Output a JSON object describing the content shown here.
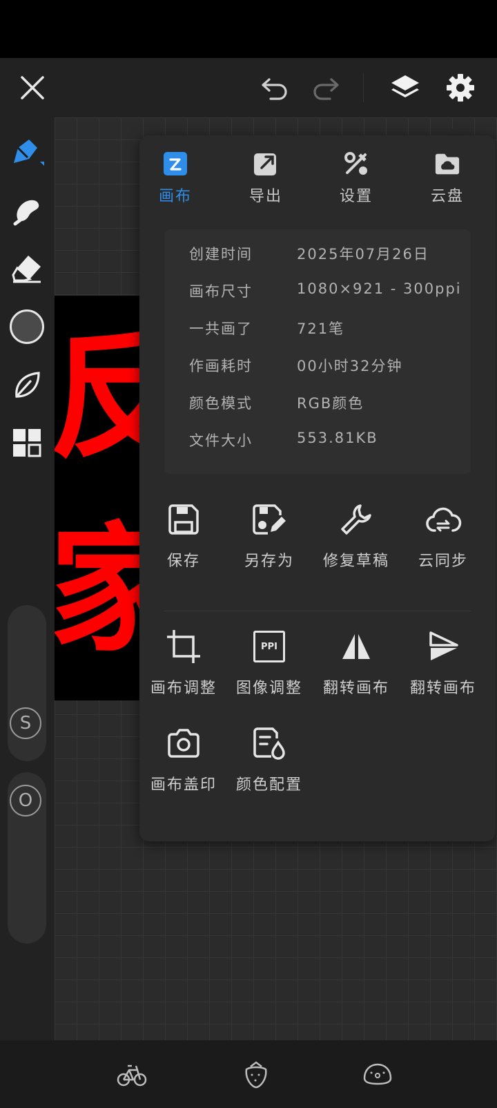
{
  "colors": {
    "accent": "#2e8eea",
    "stroke": "#ff0000"
  },
  "topbar": {
    "close_icon": "close-icon",
    "undo_icon": "undo-icon",
    "redo_icon": "redo-icon",
    "layers_icon": "layers-icon",
    "settings_icon": "gear-icon"
  },
  "left_tools": [
    "brush-tool",
    "smudge-tool",
    "eraser-tool",
    "color-swatch",
    "leaf-tool",
    "grid-tool"
  ],
  "size_slider": {
    "label": "S"
  },
  "opacity_slider": {
    "label": "O"
  },
  "artwork": {
    "text": "反家"
  },
  "panel": {
    "tabs": [
      {
        "label": "画布",
        "icon": "canvas-icon",
        "active": true
      },
      {
        "label": "导出",
        "icon": "export-icon",
        "active": false
      },
      {
        "label": "设置",
        "icon": "tools-icon",
        "active": false
      },
      {
        "label": "云盘",
        "icon": "cloud-folder-icon",
        "active": false
      }
    ],
    "info": [
      {
        "key": "创建时间",
        "value": "2025年07月26日"
      },
      {
        "key": "画布尺寸",
        "value": "1080×921 - 300ppi"
      },
      {
        "key": "一共画了",
        "value": "721笔"
      },
      {
        "key": "作画耗时",
        "value": "00小时32分钟"
      },
      {
        "key": "颜色模式",
        "value": "RGB颜色"
      },
      {
        "key": "文件大小",
        "value": "553.81KB"
      }
    ],
    "actions_row1": [
      {
        "label": "保存",
        "icon": "save-icon"
      },
      {
        "label": "另存为",
        "icon": "save-as-icon"
      },
      {
        "label": "修复草稿",
        "icon": "wrench-icon"
      },
      {
        "label": "云同步",
        "icon": "cloud-sync-icon"
      }
    ],
    "actions_row2": [
      {
        "label": "画布调整",
        "icon": "crop-icon"
      },
      {
        "label": "图像调整",
        "icon": "ppi-icon",
        "icon_text": "PPI"
      },
      {
        "label": "翻转画布",
        "icon": "flip-horizontal-icon"
      },
      {
        "label": "翻转画布",
        "icon": "flip-vertical-icon"
      }
    ],
    "actions_row3": [
      {
        "label": "画布盖印",
        "icon": "camera-icon"
      },
      {
        "label": "颜色配置",
        "icon": "color-config-icon"
      }
    ]
  },
  "bottombar": [
    "bicycle-icon",
    "strawberry-icon",
    "cookie-icon"
  ]
}
